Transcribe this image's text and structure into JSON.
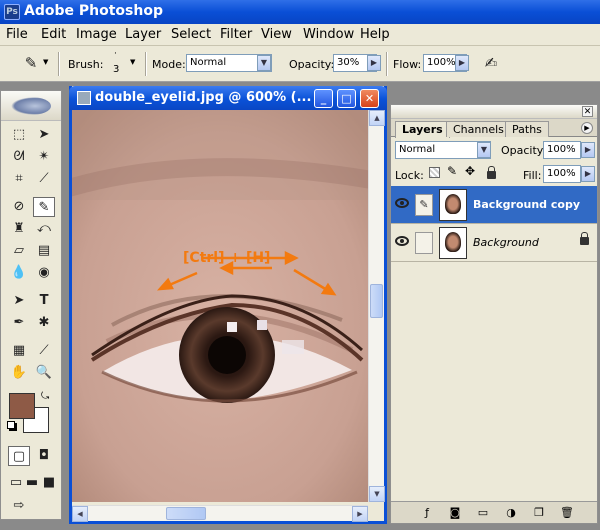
{
  "app": {
    "title": "Adobe Photoshop",
    "icon_text": "Ps"
  },
  "menu": [
    "File",
    "Edit",
    "Image",
    "Layer",
    "Select",
    "Filter",
    "View",
    "Window",
    "Help"
  ],
  "options": {
    "brush_label": "Brush:",
    "brush_size": "3",
    "mode_label": "Mode:",
    "mode_value": "Normal",
    "opacity_label": "Opacity:",
    "opacity_value": "30%",
    "flow_label": "Flow:",
    "flow_value": "100%"
  },
  "document": {
    "title": "double_eyelid.jpg @ 600% (...",
    "annotation": "[Ctrl] + [H]",
    "annotation_color": "#f37a10"
  },
  "layers_panel": {
    "tabs": [
      "Layers",
      "Channels",
      "Paths"
    ],
    "blend_mode": "Normal",
    "opacity_label": "Opacity:",
    "opacity_value": "100%",
    "lock_label": "Lock:",
    "fill_label": "Fill:",
    "fill_value": "100%",
    "layers": [
      {
        "name": "Background copy",
        "selected": true
      },
      {
        "name": "Background",
        "selected": false
      }
    ]
  },
  "colors": {
    "foreground": "#8e5a46",
    "background": "#ffffff",
    "selection": "#316ac5"
  }
}
